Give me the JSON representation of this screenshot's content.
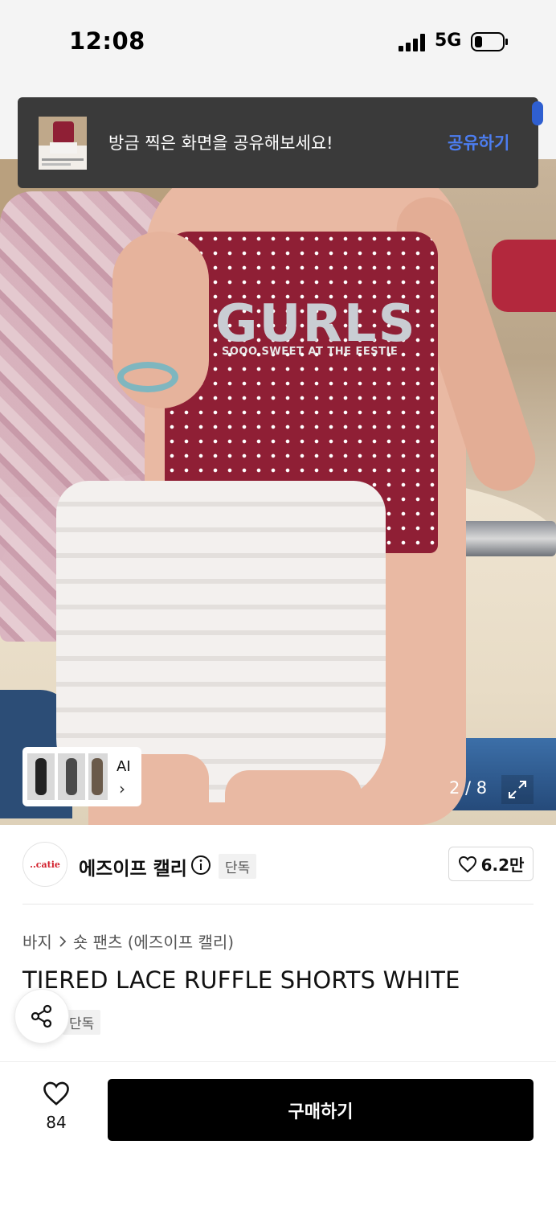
{
  "status_bar": {
    "time": "12:08",
    "network": "5G",
    "icons": [
      "signal-icon",
      "battery-icon"
    ]
  },
  "toast": {
    "message": "방금 찍은 화면을 공유해보세요!",
    "action_label": "공유하기",
    "action_color": "#4c7df0"
  },
  "gallery": {
    "ai_label": "AI",
    "page_counter": "2 / 8",
    "current_page": 2,
    "total_pages": 8,
    "icons": [
      "chevron-right-icon",
      "expand-icon"
    ],
    "shirt_print_main": "GURLS",
    "shirt_print_sub": "SOOO SWEET AT THE FESTIE"
  },
  "brand": {
    "logo_text": "..catie",
    "name": "에즈이프 캘리",
    "badge": "단독",
    "likes": "6.2만",
    "icons": [
      "info-icon",
      "heart-icon"
    ]
  },
  "breadcrumb": {
    "items": [
      "바지",
      "숏 팬츠 (에즈이프 캘리)"
    ],
    "separator_icon": "chevron-right-icon"
  },
  "product": {
    "title": "TIERED LACE RUFFLE SHORTS WHITE",
    "badge": "단독"
  },
  "bottom_bar": {
    "wish_count": "84",
    "buy_label": "구매하기",
    "icons": [
      "heart-icon",
      "share-icon"
    ]
  }
}
